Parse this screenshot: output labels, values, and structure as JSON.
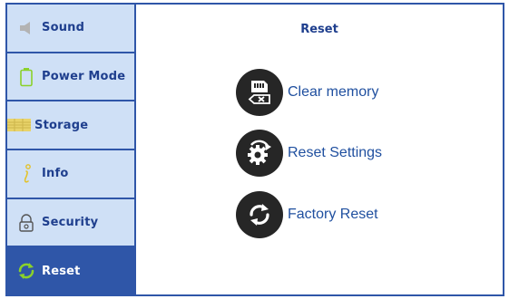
{
  "sidebar": {
    "items": [
      {
        "label": "Sound",
        "icon": "speaker-icon"
      },
      {
        "label": "Power Mode",
        "icon": "battery-icon"
      },
      {
        "label": "Storage",
        "icon": "storage-icon"
      },
      {
        "label": "Info",
        "icon": "info-icon"
      },
      {
        "label": "Security",
        "icon": "lock-icon"
      },
      {
        "label": "Reset",
        "icon": "refresh-icon",
        "active": true
      }
    ]
  },
  "main": {
    "title": "Reset",
    "actions": [
      {
        "label": "Clear memory",
        "icon": "memory-card-clear-icon"
      },
      {
        "label": "Reset Settings",
        "icon": "gear-reset-icon"
      },
      {
        "label": "Factory Reset",
        "icon": "refresh-circle-icon"
      }
    ]
  },
  "colors": {
    "accent": "#2f56a8",
    "sidebar_bg": "#cfe0f6",
    "text_blue": "#1f3f8e",
    "icon_dark": "#262626",
    "refresh_green": "#8bd12a"
  }
}
